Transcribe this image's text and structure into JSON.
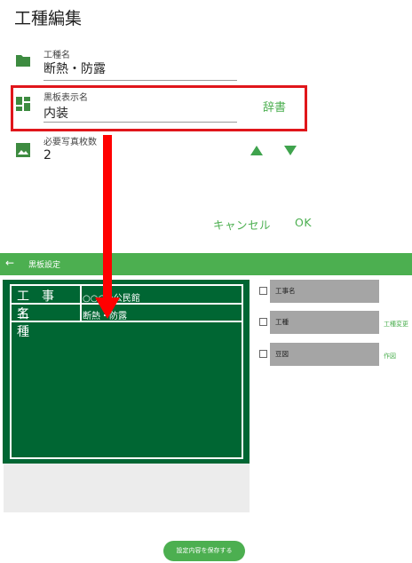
{
  "dialog": {
    "title": "工種編集",
    "fields": [
      {
        "label": "工種名",
        "value": "断熱・防露",
        "icon": "folder-icon"
      },
      {
        "label": "黒板表示名",
        "value": "内装",
        "icon": "dashboard-icon"
      },
      {
        "label": "必要写真枚数",
        "value": "2",
        "icon": "image-icon"
      }
    ],
    "dictionary_label": "辞書",
    "cancel_label": "キャンセル",
    "ok_label": "OK",
    "colors": {
      "accent": "#4caf50",
      "highlight": "#e0161b"
    }
  },
  "board_screen": {
    "appbar_title": "黒板設定",
    "back_icon": "arrow-left-icon",
    "board": {
      "rows": [
        {
          "key": "工　事　名",
          "value": "○○○○公民館"
        },
        {
          "key": "工　　　種",
          "value": "断熱・防露"
        }
      ],
      "color": "#006633"
    },
    "options": [
      {
        "label": "工事名",
        "action": ""
      },
      {
        "label": "工種",
        "action": "工種変更"
      },
      {
        "label": "豆図",
        "action": "作図"
      }
    ],
    "save_label": "設定内容を保存する"
  }
}
